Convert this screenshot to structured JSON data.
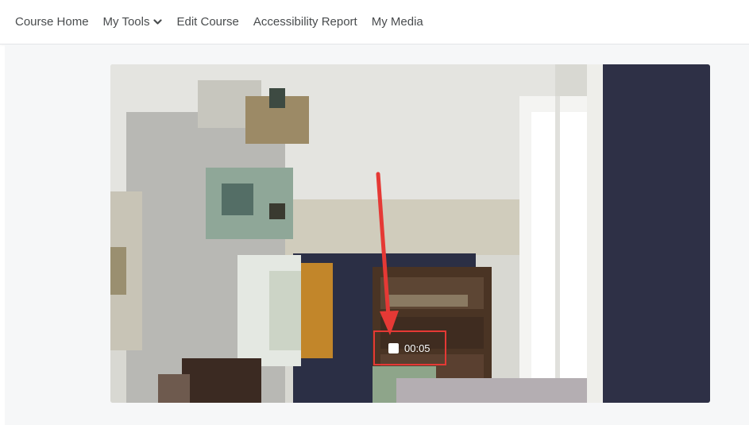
{
  "nav": {
    "items": [
      {
        "label": "Course Home"
      },
      {
        "label": "My Tools",
        "has_dropdown": true
      },
      {
        "label": "Edit Course"
      },
      {
        "label": "Accessibility Report"
      },
      {
        "label": "My Media"
      }
    ]
  },
  "recorder": {
    "elapsed": "00:05",
    "stop_icon": "stop-square-icon"
  },
  "annotation": {
    "color": "#e53935"
  }
}
